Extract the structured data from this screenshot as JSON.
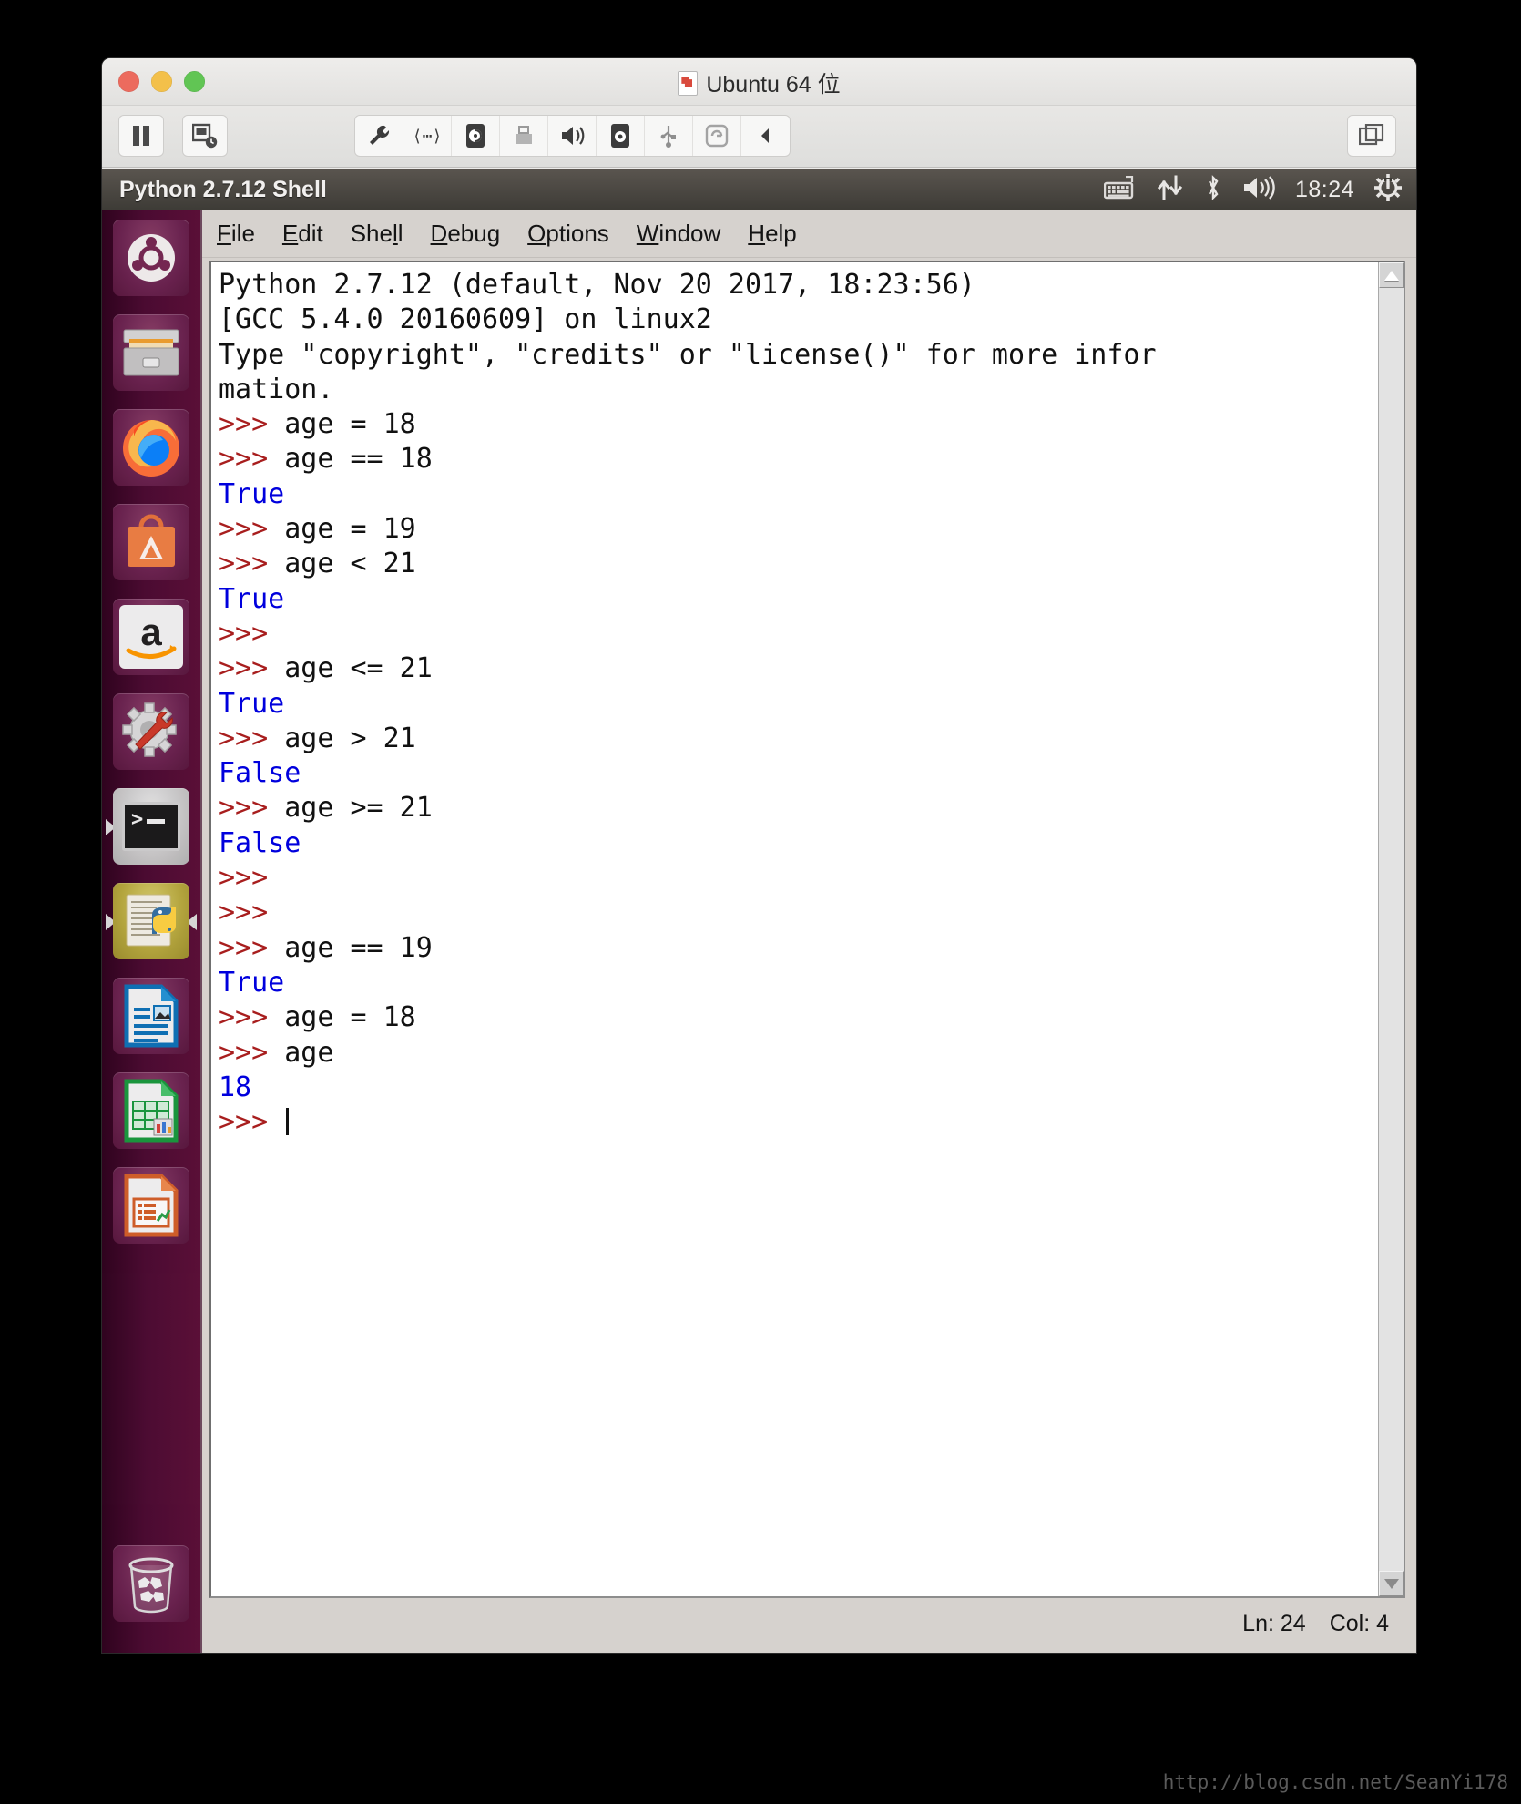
{
  "vm": {
    "title": "Ubuntu 64 位",
    "toolbar": {
      "pause_label": "Pause",
      "snapshot_label": "Snapshot",
      "icons": [
        "settings-wrench-icon",
        "network-icon",
        "hard-disk-icon",
        "printer-icon",
        "sound-icon",
        "camera-icon",
        "usb-icon",
        "sync-icon",
        "collapse-icon"
      ],
      "right_icon": "unity-view-icon"
    }
  },
  "unity_panel": {
    "window_title": "Python 2.7.12 Shell",
    "clock": "18:24",
    "indicators": [
      "keyboard-icon",
      "network-transfer-icon",
      "bluetooth-icon",
      "volume-icon",
      "power-gear-icon"
    ]
  },
  "launcher": {
    "items": [
      {
        "name": "ubuntu-dash",
        "label": "Dash home"
      },
      {
        "name": "files",
        "label": "Files"
      },
      {
        "name": "firefox",
        "label": "Firefox Web Browser"
      },
      {
        "name": "ubuntu-software",
        "label": "Ubuntu Software"
      },
      {
        "name": "amazon",
        "label": "Amazon"
      },
      {
        "name": "system-settings",
        "label": "System Settings"
      },
      {
        "name": "terminal",
        "label": "Terminal"
      },
      {
        "name": "idle-python",
        "label": "IDLE (Python GUI)"
      },
      {
        "name": "libreoffice-writer",
        "label": "LibreOffice Writer"
      },
      {
        "name": "libreoffice-calc",
        "label": "LibreOffice Calc"
      },
      {
        "name": "libreoffice-impress",
        "label": "LibreOffice Impress"
      }
    ],
    "trash": {
      "name": "trash",
      "label": "Trash"
    }
  },
  "idle": {
    "menu": [
      {
        "label": "File",
        "mnemonic": "F"
      },
      {
        "label": "Edit",
        "mnemonic": "E"
      },
      {
        "label": "Shell",
        "mnemonic": "l"
      },
      {
        "label": "Debug",
        "mnemonic": "D"
      },
      {
        "label": "Options",
        "mnemonic": "O"
      },
      {
        "label": "Window",
        "mnemonic": "W"
      },
      {
        "label": "Help",
        "mnemonic": "H"
      }
    ],
    "lines": [
      {
        "type": "header",
        "text": "Python 2.7.12 (default, Nov 20 2017, 18:23:56)"
      },
      {
        "type": "header",
        "text": "[GCC 5.4.0 20160609] on linux2"
      },
      {
        "type": "header",
        "text": "Type \"copyright\", \"credits\" or \"license()\" for more infor"
      },
      {
        "type": "header",
        "text": "mation."
      },
      {
        "type": "input",
        "prompt": ">>> ",
        "text": "age = 18"
      },
      {
        "type": "input",
        "prompt": ">>> ",
        "text": "age == 18"
      },
      {
        "type": "output",
        "text": "True"
      },
      {
        "type": "input",
        "prompt": ">>> ",
        "text": "age = 19"
      },
      {
        "type": "input",
        "prompt": ">>> ",
        "text": "age < 21"
      },
      {
        "type": "output",
        "text": "True"
      },
      {
        "type": "input",
        "prompt": ">>>",
        "text": ""
      },
      {
        "type": "input",
        "prompt": ">>> ",
        "text": "age <= 21"
      },
      {
        "type": "output",
        "text": "True"
      },
      {
        "type": "input",
        "prompt": ">>> ",
        "text": "age > 21"
      },
      {
        "type": "output",
        "text": "False"
      },
      {
        "type": "input",
        "prompt": ">>> ",
        "text": "age >= 21"
      },
      {
        "type": "output",
        "text": "False"
      },
      {
        "type": "input",
        "prompt": ">>>",
        "text": ""
      },
      {
        "type": "input",
        "prompt": ">>>",
        "text": ""
      },
      {
        "type": "input",
        "prompt": ">>> ",
        "text": "age == 19"
      },
      {
        "type": "output",
        "text": "True"
      },
      {
        "type": "input",
        "prompt": ">>> ",
        "text": "age = 18"
      },
      {
        "type": "input",
        "prompt": ">>> ",
        "text": "age"
      },
      {
        "type": "output",
        "text": "18"
      },
      {
        "type": "caret",
        "prompt": ">>> ",
        "text": ""
      }
    ],
    "status": {
      "line": "Ln: 24",
      "column": "Col: 4"
    }
  },
  "watermark": "http://blog.csdn.net/SeanYi178",
  "colors": {
    "prompt": "#a81e1e",
    "output": "#0000dd",
    "code": "#111111",
    "ubuntu_aubergine": "#2c001e",
    "panel": "#3d3b36"
  }
}
